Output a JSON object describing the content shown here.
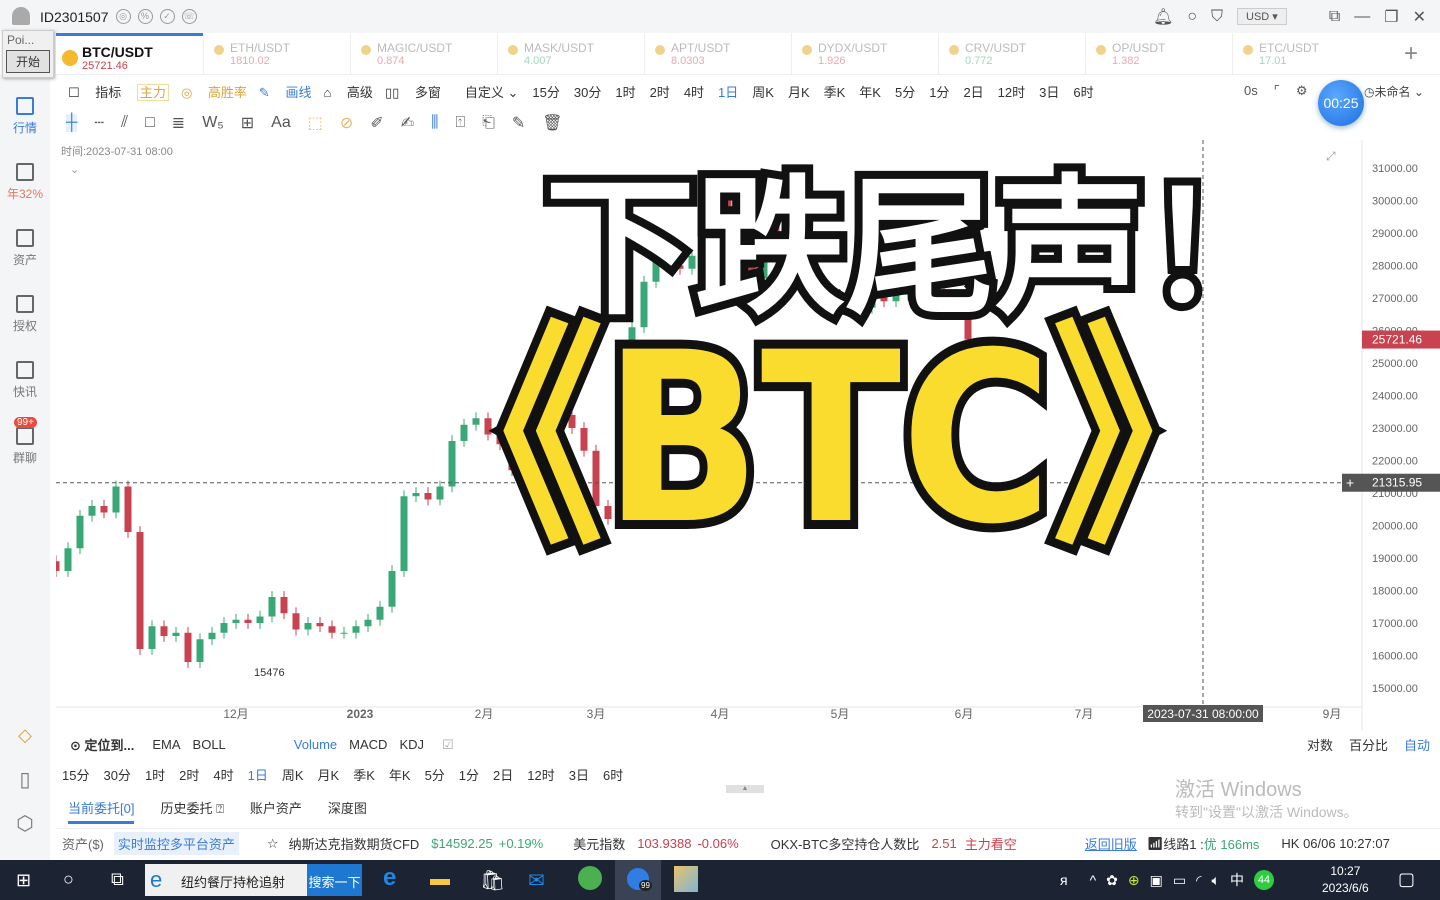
{
  "topbar": {
    "user_id": "ID2301507",
    "currency": "USD",
    "win_icons": [
      "bell-icon",
      "search-icon",
      "shirt-icon"
    ]
  },
  "popup": {
    "label": "Poi...",
    "start_button": "开始"
  },
  "sidebar": {
    "items": [
      {
        "label": "行情"
      },
      {
        "label": "年32%"
      },
      {
        "label": "资产"
      },
      {
        "label": "授权"
      },
      {
        "label": "快讯"
      },
      {
        "label": "群聊",
        "badge": "99+"
      }
    ]
  },
  "tabs": [
    {
      "name": "BTC/USDT",
      "price": "25721.46",
      "color": "#c8424f",
      "active": true
    },
    {
      "name": "ETH/USDT",
      "price": "1810.02",
      "color": "#e8aab0"
    },
    {
      "name": "MAGIC/USDT",
      "price": "0.874",
      "color": "#e8aab0"
    },
    {
      "name": "MASK/USDT",
      "price": "4.007",
      "color": "#9fd8bb"
    },
    {
      "name": "APT/USDT",
      "price": "8.0303",
      "color": "#e8aab0"
    },
    {
      "name": "DYDX/USDT",
      "price": "1.926",
      "color": "#e8aab0"
    },
    {
      "name": "CRV/USDT",
      "price": "0.772",
      "color": "#9fd8bb"
    },
    {
      "name": "OP/USDT",
      "price": "1.382",
      "color": "#e8aab0"
    },
    {
      "name": "ETC/USDT",
      "price": "17.01",
      "color": "#9fd8bb"
    }
  ],
  "toolbar": {
    "indicator": "指标",
    "main": "主力",
    "winrate": "高胜率",
    "draw": "画线",
    "advanced": "高级",
    "multi": "多窗",
    "custom": "自定义",
    "periods": [
      "15分",
      "30分",
      "1时",
      "2时",
      "4时",
      "1日",
      "周K",
      "月K",
      "季K",
      "年K",
      "5分",
      "1分",
      "2日",
      "12时",
      "3日",
      "6时"
    ],
    "active_period": "1日",
    "countdown": "0s",
    "timer": "00:25",
    "layout_name": "未命名"
  },
  "chart_info": {
    "time_label": "时间:2023-07-31 08:00",
    "crosshair_price": "21315.95",
    "crosshair_date": "2023-07-31 08:00:00",
    "last_price": "25721.46",
    "low_label": "15476"
  },
  "overlay": {
    "line1": "下跌尾声！",
    "line2": "《BTC》"
  },
  "chart_data": {
    "type": "candlestick",
    "y_ticks": [
      "31000.00",
      "30000.00",
      "29000.00",
      "28000.00",
      "27000.00",
      "26000.00",
      "25000.00",
      "24000.00",
      "23000.00",
      "22000.00",
      "21000.00",
      "20000.00",
      "19000.00",
      "18000.00",
      "17000.00",
      "16000.00",
      "15000.00"
    ],
    "ylim": [
      15000,
      31000
    ],
    "x_ticks": [
      {
        "label": "12月",
        "date": "2022-12-01"
      },
      {
        "label": "2023",
        "date": "2023-01-01"
      },
      {
        "label": "2月",
        "date": "2023-02-01"
      },
      {
        "label": "3月",
        "date": "2023-03-01"
      },
      {
        "label": "4月",
        "date": "2023-04-01"
      },
      {
        "label": "5月",
        "date": "2023-05-01"
      },
      {
        "label": "6月",
        "date": "2023-06-01"
      },
      {
        "label": "7月",
        "date": "2023-07-01"
      },
      {
        "label": "9月",
        "date": "2023-09-01"
      }
    ],
    "dates": [
      "2022-10-14",
      "2022-10-17",
      "2022-10-20",
      "2022-10-23",
      "2022-10-26",
      "2022-10-29",
      "2022-11-01",
      "2022-11-04",
      "2022-11-07",
      "2022-11-10",
      "2022-11-13",
      "2022-11-16",
      "2022-11-19",
      "2022-11-22",
      "2022-11-25",
      "2022-11-28",
      "2022-12-01",
      "2022-12-04",
      "2022-12-07",
      "2022-12-10",
      "2022-12-13",
      "2022-12-16",
      "2022-12-19",
      "2022-12-22",
      "2022-12-25",
      "2022-12-28",
      "2022-12-31",
      "2023-01-03",
      "2023-01-06",
      "2023-01-09",
      "2023-01-12",
      "2023-01-15",
      "2023-01-18",
      "2023-01-21",
      "2023-01-24",
      "2023-01-27",
      "2023-01-30",
      "2023-02-02",
      "2023-02-05",
      "2023-02-08",
      "2023-02-11",
      "2023-02-14",
      "2023-02-17",
      "2023-02-20",
      "2023-02-23",
      "2023-02-26",
      "2023-03-01",
      "2023-03-04",
      "2023-03-07",
      "2023-03-10",
      "2023-03-13",
      "2023-03-16",
      "2023-03-19",
      "2023-03-22",
      "2023-03-25",
      "2023-03-28",
      "2023-03-31",
      "2023-04-03",
      "2023-04-06",
      "2023-04-09",
      "2023-04-12",
      "2023-04-15",
      "2023-04-18",
      "2023-04-21",
      "2023-04-24",
      "2023-04-27",
      "2023-04-30",
      "2023-05-03",
      "2023-05-06",
      "2023-05-09",
      "2023-05-12",
      "2023-05-15",
      "2023-05-18",
      "2023-05-21",
      "2023-05-24",
      "2023-05-27",
      "2023-05-30",
      "2023-06-02"
    ],
    "closes": [
      18900,
      18600,
      19300,
      20300,
      20600,
      20400,
      21200,
      19800,
      16200,
      16900,
      16600,
      16700,
      15800,
      16500,
      16700,
      17000,
      17100,
      17000,
      17200,
      17800,
      17300,
      16800,
      17000,
      16900,
      16700,
      16700,
      16900,
      17100,
      17500,
      18600,
      20900,
      21000,
      20800,
      21200,
      22600,
      23100,
      23300,
      22800,
      22500,
      21700,
      23800,
      24400,
      24100,
      23400,
      23000,
      22300,
      20600,
      20200,
      22400,
      26100,
      27500,
      28200,
      28000,
      27900,
      28300,
      28100,
      30200,
      29800,
      28200,
      27600,
      29300,
      28700,
      28900,
      27700,
      26900,
      27100,
      26800,
      27000,
      26700,
      27200,
      26900,
      27100,
      27300,
      26800,
      27200,
      26900,
      27100,
      25721.46
    ],
    "up_color": "#3aa876",
    "down_color": "#c8424f"
  },
  "bottom": {
    "locate": "定位到...",
    "main_inds": [
      "EMA",
      "BOLL"
    ],
    "sub_inds": [
      "Volume",
      "MACD",
      "KDJ"
    ],
    "scale": [
      "对数",
      "百分比",
      "自动"
    ],
    "tabs": [
      "当前委托[0]",
      "历史委托",
      "账户资产",
      "深度图"
    ]
  },
  "status": {
    "assets": "资产($)",
    "monitor": "实时监控多平台资产",
    "nasdaq_label": "纳斯达克指数期货CFD",
    "nasdaq_price": "$14592.25",
    "nasdaq_change": "+0.19%",
    "dxy_label": "美元指数",
    "dxy_value": "103.9388",
    "dxy_change": "-0.06%",
    "okx_label": "OKX-BTC多空持仓人数比",
    "okx_value": "2.51",
    "okx_signal": "主力看空",
    "old_version": "返回旧版",
    "line": "线路1 : ",
    "line_quality": "优 166ms",
    "clock": "HK 06/06 10:27:07"
  },
  "watermark": {
    "title": "激活 Windows",
    "sub": "转到\"设置\"以激活 Windows。"
  },
  "taskbar": {
    "search_text": "纽约餐厅持枪追射",
    "search_button": "搜索一下",
    "time": "10:27",
    "date": "2023/6/6",
    "ime": "中",
    "badge": "44",
    "app_badge": "99"
  }
}
